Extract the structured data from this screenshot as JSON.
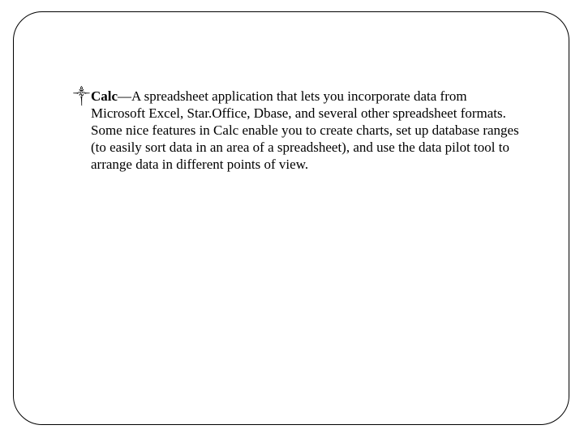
{
  "bullet_glyph": "༒",
  "item": {
    "term": "Calc",
    "sep": "—",
    "desc": "A spreadsheet application that lets you incorporate data from Microsoft Excel, Star.Office, Dbase, and several other spreadsheet formats. Some nice features in Calc enable you to create charts, set up database ranges (to easily sort data in an area of a spreadsheet), and use the data pilot tool to arrange data in different points of view."
  }
}
